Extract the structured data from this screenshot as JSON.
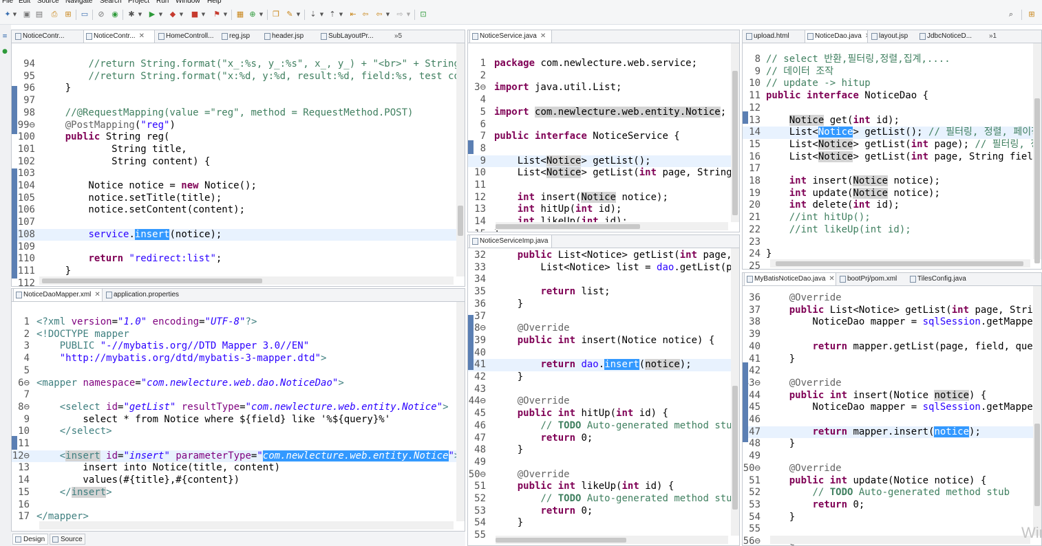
{
  "menu": [
    "File",
    "Edit",
    "Source",
    "Navigate",
    "Search",
    "Project",
    "Run",
    "Window",
    "Help"
  ],
  "panels": {
    "controller": {
      "tabs": [
        "NoticeContr...",
        "NoticeContr...",
        "HomeControll...",
        "reg.jsp",
        "header.jsp",
        "SubLayoutPr..."
      ],
      "overflow": "»5",
      "lines": [
        {
          "n": "94",
          "html": "        <span class='c'>//return String.format(\"x_:%s, y_:%s\", x_, y_) + \"&lt;br&gt;\" + String.</span>"
        },
        {
          "n": "95",
          "html": "        <span class='c'>//return String.format(\"x:%d, y:%d, result:%d, field:%s, test cool</span>"
        },
        {
          "n": "96",
          "html": "    }"
        },
        {
          "n": "97",
          "html": ""
        },
        {
          "n": "98",
          "html": "    <span class='c'>//@RequestMapping(value =\"reg\", method = RequestMethod.POST)</span>"
        },
        {
          "n": "99⊖",
          "html": "    <span class='a'>@PostMapping</span>(<span class='s'>\"reg\"</span>)"
        },
        {
          "n": "100",
          "html": "    <span class='k'>public</span> String reg("
        },
        {
          "n": "101",
          "html": "            String title,"
        },
        {
          "n": "102",
          "html": "            String content) {"
        },
        {
          "n": "103",
          "html": ""
        },
        {
          "n": "104",
          "html": "        Notice notice = <span class='k'>new</span> Notice();"
        },
        {
          "n": "105",
          "html": "        notice.setTitle(title);"
        },
        {
          "n": "106",
          "html": "        notice.setContent(content);"
        },
        {
          "n": "107",
          "html": ""
        },
        {
          "n": "108",
          "html": "        <span class='s'>service</span>.<span class='sel'>insert</span>(notice);",
          "cur": true
        },
        {
          "n": "109",
          "html": ""
        },
        {
          "n": "110",
          "html": "        <span class='k'>return</span> <span class='s'>\"redirect:list\"</span>;"
        },
        {
          "n": "111",
          "html": "    }"
        },
        {
          "n": "112",
          "html": ""
        }
      ]
    },
    "mapper": {
      "tabs": [
        "NoticeDaoMapper.xml",
        "application.properties"
      ],
      "lines": [
        {
          "n": "1",
          "html": "<span class='x'>&lt;?xml</span> <span class='at'>version</span>=<span class='av'>\"1.0\"</span> <span class='at'>encoding</span>=<span class='av'>\"UTF-8\"</span><span class='x'>?&gt;</span>"
        },
        {
          "n": "2",
          "html": "<span class='x'>&lt;!DOCTYPE mapper</span>"
        },
        {
          "n": "3",
          "html": "    <span class='x'>PUBLIC</span> <span class='s'>\"-//mybatis.org//DTD Mapper 3.0//EN\"</span>"
        },
        {
          "n": "4",
          "html": "    <span class='s'>\"http://mybatis.org/dtd/mybatis-3-mapper.dtd\"</span><span class='x'>&gt;</span>"
        },
        {
          "n": "5",
          "html": ""
        },
        {
          "n": "6⊖",
          "html": "<span class='x'>&lt;mapper</span> <span class='at'>namespace</span>=<span class='av'>\"com.newlecture.web.dao.NoticeDao\"</span><span class='x'>&gt;</span>"
        },
        {
          "n": "7",
          "html": ""
        },
        {
          "n": "8⊖",
          "html": "    <span class='x'>&lt;select</span> <span class='at'>id</span>=<span class='av'>\"getList\"</span> <span class='at'>resultType</span>=<span class='av'>\"com.newlecture.web.entity.Notice\"</span><span class='x'>&gt;</span>"
        },
        {
          "n": "9",
          "html": "        select * from Notice where ${field} like '%${query}%'"
        },
        {
          "n": "10",
          "html": "    <span class='x'>&lt;/select&gt;</span>"
        },
        {
          "n": "11",
          "html": ""
        },
        {
          "n": "12⊖",
          "html": "    <span class='x'>&lt;<span class='occ'>insert</span></span> <span class='at'>id</span>=<span class='av'>\"insert\"</span> <span class='at'>parameterType</span>=<span class='av'>\"<span class='sel'>com.newlecture.web.entity.Notice</span>\"</span><span class='x'>&gt;</span>",
          "cur": true
        },
        {
          "n": "13",
          "html": "        insert into Notice(title, content)"
        },
        {
          "n": "14",
          "html": "        values(#{title},#{content})"
        },
        {
          "n": "15",
          "html": "    <span class='x'>&lt;/<span class='occ'>insert</span>&gt;</span>"
        },
        {
          "n": "16",
          "html": ""
        },
        {
          "n": "17",
          "html": "<span class='x'>&lt;/mapper&gt;</span>"
        }
      ],
      "bottom_tabs": [
        "Design",
        "Source"
      ]
    },
    "service": {
      "tabs": [
        "NoticeService.java"
      ],
      "lines": [
        {
          "n": "1",
          "html": "<span class='k'>package</span> com.newlecture.web.service;"
        },
        {
          "n": "2",
          "html": ""
        },
        {
          "n": "3⊖",
          "html": "<span class='k'>import</span> java.util.List;"
        },
        {
          "n": "4",
          "html": ""
        },
        {
          "n": "5",
          "html": "<span class='k'>import</span> <span class='occ'>com.newlecture.web.entity.Notice</span>;"
        },
        {
          "n": "6",
          "html": ""
        },
        {
          "n": "7",
          "html": "<span class='k'>public</span> <span class='k'>interface</span> NoticeService {"
        },
        {
          "n": "8",
          "html": ""
        },
        {
          "n": "9",
          "html": "    List&lt;<span class='occ'>Notice</span>&gt; getList();",
          "cur": true
        },
        {
          "n": "10",
          "html": "    List&lt;<span class='occ'>Notice</span>&gt; getList(<span class='k'>int</span> page, String"
        },
        {
          "n": "11",
          "html": ""
        },
        {
          "n": "12",
          "html": "    <span class='k'>int</span> insert(<span class='occ'>Notice</span> notice);"
        },
        {
          "n": "13",
          "html": "    <span class='k'>int</span> hitUp(<span class='k'>int</span> id);"
        },
        {
          "n": "14",
          "html": "    <span class='k'>int</span> likeUp(<span class='k'>int</span> id);"
        },
        {
          "n": "15",
          "html": "}"
        }
      ]
    },
    "serviceimp": {
      "tabs": [
        "NoticeServiceImp.java"
      ],
      "lines": [
        {
          "n": "32",
          "html": "    <span class='k'>public</span> List&lt;Notice&gt; getList(<span class='k'>int</span> page,"
        },
        {
          "n": "33",
          "html": "        List&lt;Notice&gt; list = <span class='s'>dao</span>.getList(pa"
        },
        {
          "n": "34",
          "html": ""
        },
        {
          "n": "35",
          "html": "        <span class='k'>return</span> list;"
        },
        {
          "n": "36",
          "html": "    }"
        },
        {
          "n": "37",
          "html": ""
        },
        {
          "n": "38⊖",
          "html": "    <span class='a'>@Override</span>"
        },
        {
          "n": "39",
          "html": "    <span class='k'>public</span> <span class='k'>int</span> insert(Notice notice) {"
        },
        {
          "n": "40",
          "html": ""
        },
        {
          "n": "41",
          "html": "        <span class='k'>return</span> <span class='s'>dao</span>.<span class='sel'>insert</span>(<span class='occ'>notice</span>);",
          "cur": true
        },
        {
          "n": "42",
          "html": "    }"
        },
        {
          "n": "43",
          "html": ""
        },
        {
          "n": "44⊖",
          "html": "    <span class='a'>@Override</span>"
        },
        {
          "n": "45",
          "html": "    <span class='k'>public</span> <span class='k'>int</span> hitUp(<span class='k'>int</span> id) {"
        },
        {
          "n": "46",
          "html": "        <span class='c'>// <b>TODO</b> Auto-generated method stub</span>"
        },
        {
          "n": "47",
          "html": "        <span class='k'>return</span> 0;"
        },
        {
          "n": "48",
          "html": "    }"
        },
        {
          "n": "49",
          "html": ""
        },
        {
          "n": "50⊖",
          "html": "    <span class='a'>@Override</span>"
        },
        {
          "n": "51",
          "html": "    <span class='k'>public</span> <span class='k'>int</span> likeUp(<span class='k'>int</span> id) {"
        },
        {
          "n": "52",
          "html": "        <span class='c'>// <b>TODO</b> Auto-generated method stub</span>"
        },
        {
          "n": "53",
          "html": "        <span class='k'>return</span> 0;"
        },
        {
          "n": "54",
          "html": "    }"
        },
        {
          "n": "55",
          "html": ""
        }
      ]
    },
    "dao": {
      "tabs": [
        "upload.html",
        "NoticeDao.java",
        "layout.jsp",
        "JdbcNoticeD..."
      ],
      "overflow": "»1",
      "lines": [
        {
          "n": "8",
          "html": "<span class='c'>// select 반환,필터링,정렬,집계,....</span>"
        },
        {
          "n": "9",
          "html": "<span class='c'>// 데이터 조작</span>"
        },
        {
          "n": "10",
          "html": "<span class='c'>// update -&gt; hitup</span>"
        },
        {
          "n": "11",
          "html": "<span class='k'>public</span> <span class='k'>interface</span> NoticeDao {"
        },
        {
          "n": "12",
          "html": ""
        },
        {
          "n": "13",
          "html": "    <span class='occ'>Notice</span> get(<span class='k'>int</span> id);"
        },
        {
          "n": "14",
          "html": "    List&lt;<span class='sel'>Notice</span>&gt; getList(); <span class='c'>// 필터링, 정렬, 페이징,</span>",
          "cur": true
        },
        {
          "n": "15",
          "html": "    List&lt;<span class='occ'>Notice</span>&gt; getList(<span class='k'>int</span> page); <span class='c'>// 필터링, 정렬</span>"
        },
        {
          "n": "16",
          "html": "    List&lt;<span class='occ'>Notice</span>&gt; getList(<span class='k'>int</span> page, String field,"
        },
        {
          "n": "17",
          "html": ""
        },
        {
          "n": "18",
          "html": "    <span class='k'>int</span> insert(<span class='occ'>Notice</span> notice);"
        },
        {
          "n": "19",
          "html": "    <span class='k'>int</span> update(<span class='occ'>Notice</span> notice);"
        },
        {
          "n": "20",
          "html": "    <span class='k'>int</span> delete(<span class='k'>int</span> id);"
        },
        {
          "n": "21",
          "html": "    <span class='c'>//int hitUp();</span>"
        },
        {
          "n": "22",
          "html": "    <span class='c'>//int likeUp(int id);</span>"
        },
        {
          "n": "23",
          "html": ""
        },
        {
          "n": "24",
          "html": "}"
        },
        {
          "n": "25",
          "html": ""
        }
      ]
    },
    "mybatisdao": {
      "tabs": [
        "MyBatisNoticeDao.java",
        "bootPrj/pom.xml",
        "TilesConfig.java"
      ],
      "lines": [
        {
          "n": "36",
          "html": "    <span class='a'>@Override</span>"
        },
        {
          "n": "37",
          "html": "    <span class='k'>public</span> List&lt;Notice&gt; getList(<span class='k'>int</span> page, String"
        },
        {
          "n": "38",
          "html": "        NoticeDao mapper = <span class='s'>sqlSession</span>.getMapper("
        },
        {
          "n": "39",
          "html": ""
        },
        {
          "n": "40",
          "html": "        <span class='k'>return</span> mapper.getList(page, field, query"
        },
        {
          "n": "41",
          "html": "    }"
        },
        {
          "n": "42",
          "html": ""
        },
        {
          "n": "43⊖",
          "html": "    <span class='a'>@Override</span>"
        },
        {
          "n": "44",
          "html": "    <span class='k'>public</span> <span class='k'>int</span> insert(Notice <span class='occ'>notice</span>) {"
        },
        {
          "n": "45",
          "html": "        NoticeDao mapper = <span class='s'>sqlSession</span>.getMapper("
        },
        {
          "n": "46",
          "html": ""
        },
        {
          "n": "47",
          "html": "        <span class='k'>return</span> mapper.insert(<span class='sel'>notice</span>);",
          "cur": true
        },
        {
          "n": "48",
          "html": "    }"
        },
        {
          "n": "49",
          "html": ""
        },
        {
          "n": "50⊖",
          "html": "    <span class='a'>@Override</span>"
        },
        {
          "n": "51",
          "html": "    <span class='k'>public</span> <span class='k'>int</span> update(Notice notice) {"
        },
        {
          "n": "52",
          "html": "        <span class='c'>// <b>TODO</b> Auto-generated method stub</span>"
        },
        {
          "n": "53",
          "html": "        <span class='k'>return</span> 0;"
        },
        {
          "n": "54",
          "html": "    }"
        },
        {
          "n": "55",
          "html": ""
        },
        {
          "n": "56⊖",
          "html": "    <span class='a'>@Override</span>"
        }
      ]
    }
  },
  "watermark": "Wir"
}
